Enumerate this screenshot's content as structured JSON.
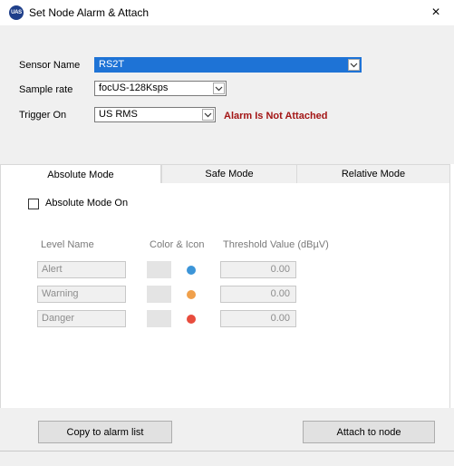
{
  "window": {
    "title": "Set Node Alarm & Attach",
    "icon_text": "UAS",
    "close_glyph": "×"
  },
  "form": {
    "sensor_name_label": "Sensor Name",
    "sensor_name_value": "RS2T",
    "sample_rate_label": "Sample rate",
    "sample_rate_value": "focUS-128Ksps",
    "trigger_on_label": "Trigger On",
    "trigger_on_value": "US RMS",
    "alarm_status": "Alarm Is Not Attached"
  },
  "tabs": [
    {
      "label": "Absolute Mode",
      "active": true
    },
    {
      "label": "Safe Mode",
      "active": false
    },
    {
      "label": "Relative Mode",
      "active": false
    }
  ],
  "absolute": {
    "checkbox_label": "Absolute Mode On",
    "checked": false,
    "headers": {
      "level_name": "Level Name",
      "color_icon": "Color & Icon",
      "threshold": "Threshold Value (dBµV)"
    },
    "levels": [
      {
        "name": "Alert",
        "color": "#3c95d8",
        "value": "0.00"
      },
      {
        "name": "Warning",
        "color": "#f0a04b",
        "value": "0.00"
      },
      {
        "name": "Danger",
        "color": "#e84c3d",
        "value": "0.00"
      }
    ]
  },
  "buttons": {
    "copy": "Copy to alarm list",
    "attach": "Attach to node"
  },
  "colors": {
    "selected_bg": "#1e73d6",
    "status_red": "#a31515"
  }
}
